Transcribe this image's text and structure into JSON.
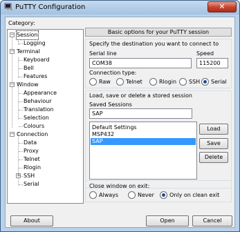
{
  "window": {
    "title": "PuTTY Configuration",
    "close_glyph": "✕"
  },
  "category_label": "Category:",
  "tree": [
    {
      "label": "Session",
      "level": 0,
      "expander": "−",
      "selected": true
    },
    {
      "label": "Logging",
      "level": 1
    },
    {
      "label": "Terminal",
      "level": 0,
      "expander": "−"
    },
    {
      "label": "Keyboard",
      "level": 1
    },
    {
      "label": "Bell",
      "level": 1
    },
    {
      "label": "Features",
      "level": 1
    },
    {
      "label": "Window",
      "level": 0,
      "expander": "−"
    },
    {
      "label": "Appearance",
      "level": 1
    },
    {
      "label": "Behaviour",
      "level": 1
    },
    {
      "label": "Translation",
      "level": 1
    },
    {
      "label": "Selection",
      "level": 1
    },
    {
      "label": "Colours",
      "level": 1
    },
    {
      "label": "Connection",
      "level": 0,
      "expander": "−"
    },
    {
      "label": "Data",
      "level": 1
    },
    {
      "label": "Proxy",
      "level": 1
    },
    {
      "label": "Telnet",
      "level": 1
    },
    {
      "label": "Rlogin",
      "level": 1
    },
    {
      "label": "SSH",
      "level": 1,
      "expander": "+"
    },
    {
      "label": "Serial",
      "level": 1
    }
  ],
  "header": "Basic options for your PuTTY session",
  "destination": {
    "title": "Specify the destination you want to connect to",
    "serial_line_label": "Serial line",
    "serial_line_value": "COM38",
    "speed_label": "Speed",
    "speed_value": "115200",
    "conn_type_label": "Connection type:",
    "types": [
      "Raw",
      "Telnet",
      "Rlogin",
      "SSH",
      "Serial"
    ],
    "selected_type": "Serial"
  },
  "sessions": {
    "title": "Load, save or delete a stored session",
    "saved_label": "Saved Sessions",
    "saved_value": "SAP",
    "list": [
      "Default Settings",
      "MSP432",
      "SAP"
    ],
    "selected": "SAP",
    "load": "Load",
    "save": "Save",
    "delete": "Delete"
  },
  "close_on_exit": {
    "label": "Close window on exit:",
    "options": [
      "Always",
      "Never",
      "Only on clean exit"
    ],
    "selected": "Only on clean exit"
  },
  "buttons": {
    "about": "About",
    "open": "Open",
    "cancel": "Cancel"
  }
}
